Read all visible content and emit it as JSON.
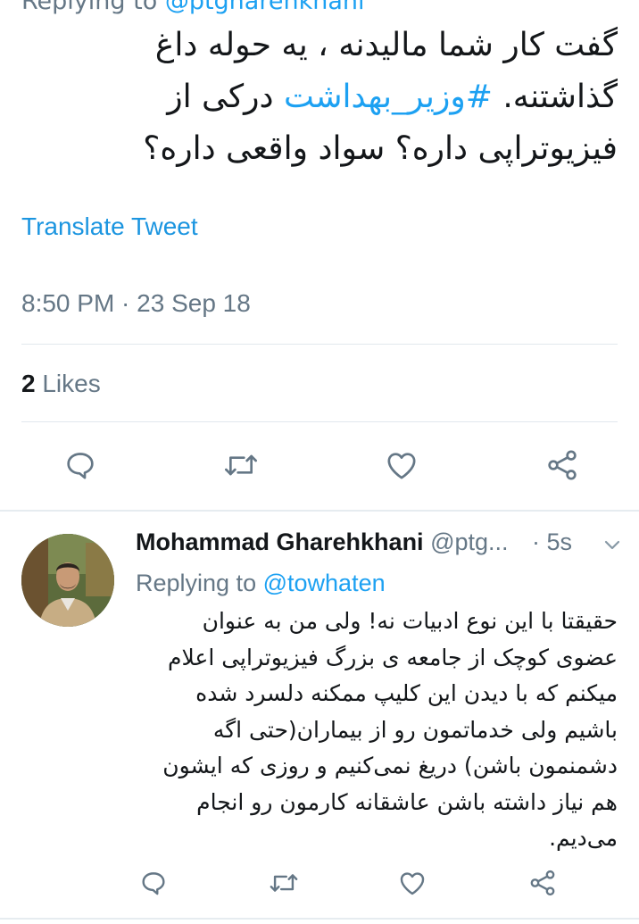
{
  "parent_tweet": {
    "replying_label": "Replying to",
    "replying_handle": "@ptgharehkhani",
    "text_before_hashtag": "گفت کار شما مالیدنه ، یه حوله داغ گذاشتنه. ",
    "hashtag": "#وزیر_بهداشت",
    "text_after_hashtag": " درکی از فیزیوتراپی داره؟ سواد واقعی داره؟",
    "translate_label": "Translate Tweet",
    "timestamp": "8:50 PM · 23 Sep 18",
    "likes_count": "2",
    "likes_label": "Likes"
  },
  "reply_tweet": {
    "author_name": "Mohammad Gharehkhani",
    "author_handle": "@ptg...",
    "time": "· 5s",
    "replying_label": "Replying to",
    "replying_handle": "@towhaten",
    "text": "حقیقتا با این نوع ادبیات نه! ولی من به عنوان عضوی کوچک از جامعه ی بزرگ فیزیوتراپی اعلام میکنم که با دیدن این کلیپ ممکنه دلسرد شده باشیم ولی خدماتمون رو از بیماران(حتی اگه دشمنمون باشن) دریغ نمی‌کنیم و روزی که ایشون هم نیاز داشته باشن عاشقانه کارمون رو انجام می‌دیم."
  },
  "icons": {
    "reply": "speech-bubble-icon",
    "retweet": "retweet-icon",
    "like": "heart-icon",
    "share": "share-icon",
    "more": "chevron-down-icon"
  },
  "colors": {
    "link_blue": "#1da1f2",
    "muted_gray": "#657786",
    "icon_gray": "#657786",
    "divider": "#e1e8ed"
  }
}
